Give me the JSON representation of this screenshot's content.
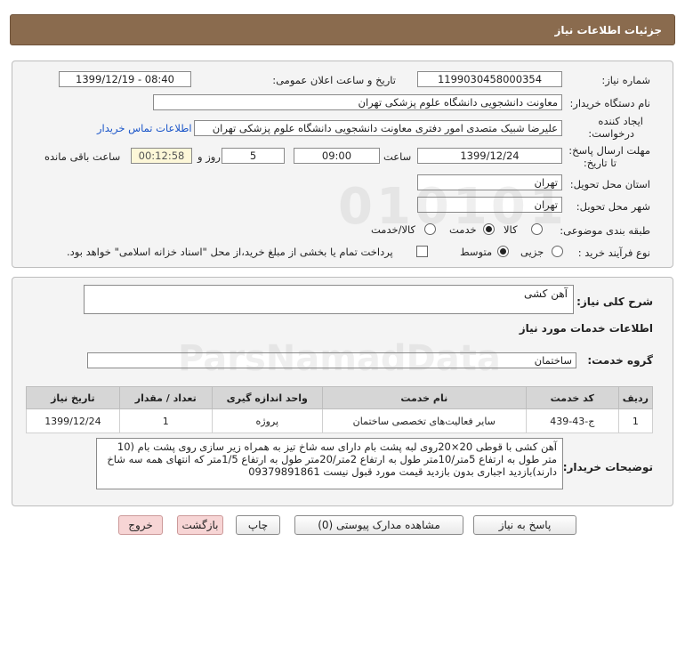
{
  "header": {
    "title": "جزئیات اطلاعات نیاز"
  },
  "info": {
    "need_number_label": "شماره نیاز:",
    "need_number": "1199030458000354",
    "announce_label": "تاریخ و ساعت اعلان عمومی:",
    "announce_value": "1399/12/19 - 08:40",
    "buyer_org_label": "نام دستگاه خریدار:",
    "buyer_org": "معاونت دانشجویی دانشگاه علوم پزشکی تهران",
    "creator_label_1": "ایجاد کننده",
    "creator_label_2": "درخواست:",
    "creator": "علیرضا شبیک متصدی امور دفتری معاونت دانشجویی دانشگاه علوم پزشکی تهران",
    "contact_link": "اطلاعات تماس خریدار",
    "deadline_label_1": "مهلت ارسال پاسخ:",
    "deadline_label_2": "تا تاریخ:",
    "deadline_date": "1399/12/24",
    "time_label": "ساعت",
    "deadline_time": "09:00",
    "days_value": "5",
    "days_label": "روز و",
    "remaining_time": "00:12:58",
    "remaining_label": "ساعت باقی مانده",
    "province_label": "استان محل تحویل:",
    "province": "تهران",
    "city_label": "شهر محل تحویل:",
    "city": "تهران",
    "category_label": "طبقه بندی موضوعی:",
    "category_options": [
      "کالا",
      "خدمت",
      "کالا/خدمت"
    ],
    "category_selected": "خدمت",
    "process_label": "نوع فرآیند خرید :",
    "process_options": [
      "جزیی",
      "متوسط"
    ],
    "process_selected": "متوسط",
    "payment_note": "پرداخت تمام یا بخشی از مبلغ خرید،از محل \"اسناد خزانه اسلامی\" خواهد بود."
  },
  "details": {
    "summary_label": "شرح کلی نیاز:",
    "summary": "آهن کشی",
    "services_heading": "اطلاعات خدمات مورد نیاز",
    "service_group_label": "گروه خدمت:",
    "service_group": "ساختمان",
    "table": {
      "headers": [
        "ردیف",
        "کد خدمت",
        "نام خدمت",
        "واحد اندازه گیری",
        "تعداد / مقدار",
        "تاریخ نیاز"
      ],
      "rows": [
        [
          "1",
          "ج-43-439",
          "سایر فعالیت‌های تخصصی ساختمان",
          "پروژه",
          "1",
          "1399/12/24"
        ]
      ]
    },
    "buyer_notes_label": "توضیحات خریدار:",
    "buyer_notes": "آهن کشی با قوطی 20×20روی لبه پشت بام دارای سه شاخ تیز  به همراه زیر سازی روی پشت بام (10 متر طول به ارتفاع 5متر/10متر طول به ارتفاع 2متر/20متر طول به ارتفاع 1/5متر که انتهای همه  سه شاخ دارند)بازدید اجباری بدون بازدید قیمت مورد قبول نیست 09379891861"
  },
  "buttons": {
    "reply": "پاسخ به نیاز",
    "attachments": "مشاهده مدارک پیوستی (0)",
    "print": "چاپ",
    "back": "بازگشت",
    "exit": "خروج"
  }
}
